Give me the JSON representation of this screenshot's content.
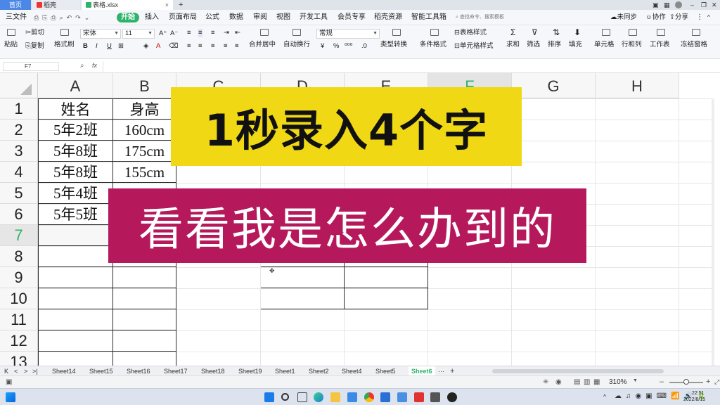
{
  "titlebar": {
    "tabs": [
      "首页",
      "稻壳",
      "表格.xlsx"
    ],
    "new_tab": "+"
  },
  "menubar": {
    "file": "三文件",
    "items": [
      "开始",
      "插入",
      "页面布局",
      "公式",
      "数据",
      "审阅",
      "视图",
      "开发工具",
      "会员专享",
      "稻壳资源",
      "智能工具箱"
    ],
    "search": "查找命令、搜索模板",
    "sync": "未同步",
    "collab": "协作",
    "share": "分享"
  },
  "ribbon": {
    "paste": "粘贴",
    "cut": "剪切",
    "copy": "复制",
    "format_painter": "格式刷",
    "font_name": "宋体",
    "font_size": "11",
    "merge": "合并居中",
    "wrap": "自动换行",
    "number_format": "常规",
    "convert": "类型转换",
    "conditional": "条件格式",
    "table_style": "表格样式",
    "cell_style": "单元格样式",
    "sum": "求和",
    "filter": "筛选",
    "sort": "排序",
    "fill": "填充",
    "cell": "单元格",
    "rowcol": "行和列",
    "sheet": "工作表",
    "freeze": "冻结窗格"
  },
  "formula_bar": {
    "name_box": "F7",
    "fx": "fx"
  },
  "grid": {
    "columns": [
      "A",
      "B",
      "C",
      "D",
      "E",
      "F",
      "G",
      "H"
    ],
    "rows": [
      "1",
      "2",
      "3",
      "4",
      "5",
      "6",
      "7",
      "8",
      "9",
      "10",
      "11",
      "12",
      "13"
    ],
    "col_a": [
      "姓名",
      "5年2班",
      "5年8班",
      "5年8班",
      "5年4班",
      "5年5班"
    ],
    "col_b": [
      "身高",
      "160cm",
      "175cm",
      "155cm"
    ]
  },
  "overlay": {
    "line1": "1秒录入4个字",
    "line2": "看看我是怎么办到的"
  },
  "sheets": {
    "tabs": [
      "Sheet14",
      "Sheet15",
      "Sheet16",
      "Sheet17",
      "Sheet18",
      "Sheet19",
      "Sheet1",
      "Sheet2",
      "Sheet4",
      "Sheet5",
      "Sheet6"
    ],
    "more": "···",
    "add": "+"
  },
  "status": {
    "zoom": "310%"
  },
  "taskbar": {
    "time": "22:51",
    "date": "2022/8/15"
  },
  "colors": {
    "accent_green": "#2fb36b",
    "overlay_yellow": "#f0d814",
    "overlay_magenta": "#b5195c"
  }
}
